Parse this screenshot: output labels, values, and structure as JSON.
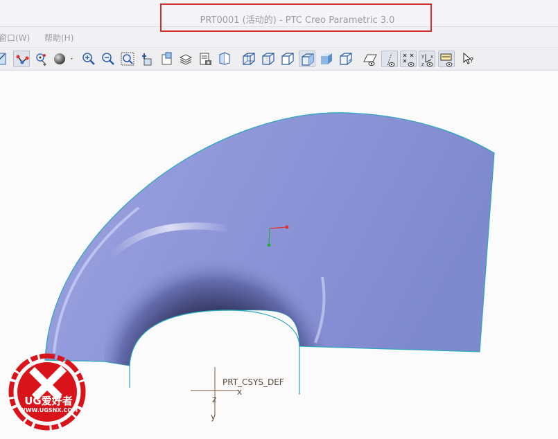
{
  "window": {
    "title": "PRT0001 (活动的) - PTC Creo Parametric 3.0"
  },
  "menu": {
    "items": [
      "窗口(W)",
      "帮助(H)"
    ]
  },
  "toolbar": {
    "icons": [
      "datum-display-icon",
      "csys-icon",
      "spin-center-icon",
      "appearance-gallery-icon",
      "zoom-in-icon",
      "zoom-out-icon",
      "refit-icon",
      "view-manager-icon",
      "named-views-icon",
      "layers-icon",
      "repaint-icon",
      "saved-orientations-icon",
      "wireframe-icon",
      "hidden-line-icon",
      "no-hidden-icon",
      "shading-with-edges-icon",
      "shading-icon",
      "shading-reflections-icon",
      "plane-display-icon",
      "axis-display-icon",
      "point-display-icon",
      "csys-display-icon",
      "annotation-display-icon",
      "whats-this-icon"
    ]
  },
  "model": {
    "csys_label": "PRT_CSYS_DEF",
    "axis_x": "x",
    "axis_y": "y",
    "axis_z": "z"
  },
  "watermark": {
    "brand": "UG爱好者",
    "url": "WWW.UGSNX.COM"
  },
  "colors": {
    "title_box": "#d0312d",
    "surface": "#8a93d6",
    "edge": "#2aa7b8"
  }
}
